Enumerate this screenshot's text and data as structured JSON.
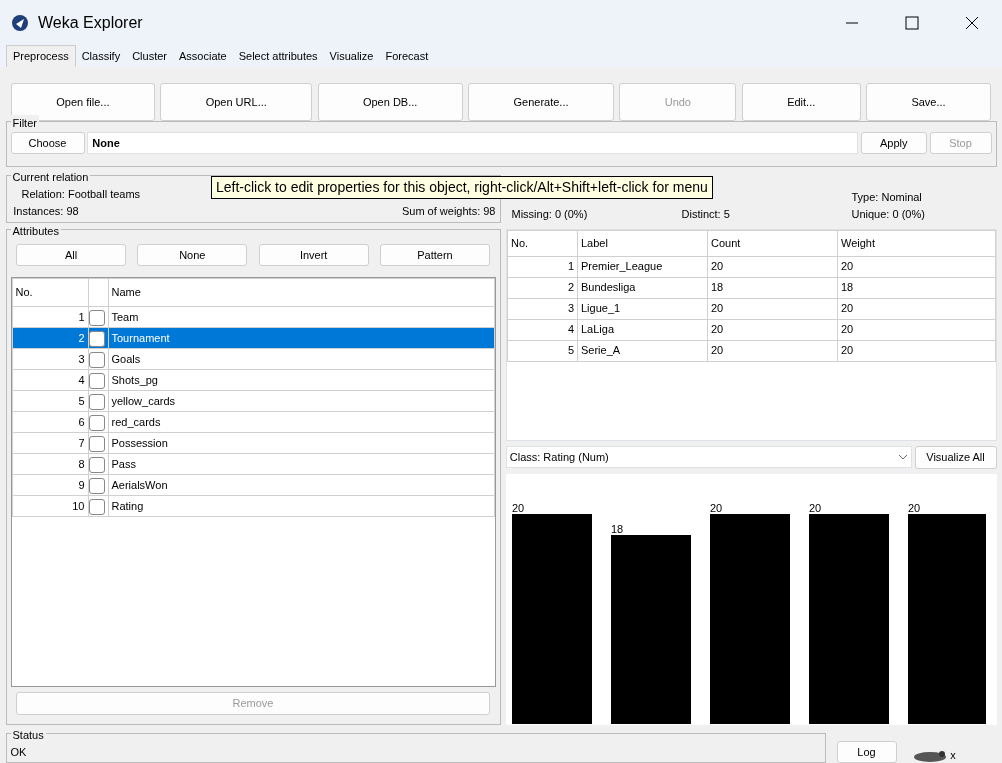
{
  "window": {
    "title": "Weka Explorer"
  },
  "tabs": [
    {
      "label": "Preprocess",
      "selected": true
    },
    {
      "label": "Classify",
      "selected": false
    },
    {
      "label": "Cluster",
      "selected": false
    },
    {
      "label": "Associate",
      "selected": false
    },
    {
      "label": "Select attributes",
      "selected": false
    },
    {
      "label": "Visualize",
      "selected": false
    },
    {
      "label": "Forecast",
      "selected": false
    }
  ],
  "toolbar": [
    {
      "label": "Open file...",
      "disabled": false
    },
    {
      "label": "Open URL...",
      "disabled": false
    },
    {
      "label": "Open DB...",
      "disabled": false
    },
    {
      "label": "Generate...",
      "disabled": false
    },
    {
      "label": "Undo",
      "disabled": true
    },
    {
      "label": "Edit...",
      "disabled": false
    },
    {
      "label": "Save...",
      "disabled": false
    }
  ],
  "filter": {
    "title": "Filter",
    "choose": "Choose",
    "value": "None",
    "apply": {
      "label": "Apply",
      "disabled": false
    },
    "stop": {
      "label": "Stop",
      "disabled": true
    }
  },
  "tooltip": "Left-click to edit properties for this object, right-click/Alt+Shift+left-click for menu",
  "current_relation": {
    "title": "Current relation",
    "relation": "Relation: Football teams",
    "instances": "Instances: 98",
    "sum_of_weights": "Sum of weights: 98"
  },
  "attributes": {
    "title": "Attributes",
    "buttons": [
      "All",
      "None",
      "Invert",
      "Pattern"
    ],
    "columns": [
      "No.",
      "Name"
    ],
    "rows": [
      {
        "no": "1",
        "name": "Team",
        "checked": false,
        "selected": false
      },
      {
        "no": "2",
        "name": "Tournament",
        "checked": false,
        "selected": true
      },
      {
        "no": "3",
        "name": "Goals",
        "checked": false,
        "selected": false
      },
      {
        "no": "4",
        "name": "Shots_pg",
        "checked": false,
        "selected": false
      },
      {
        "no": "5",
        "name": "yellow_cards",
        "checked": false,
        "selected": false
      },
      {
        "no": "6",
        "name": "red_cards",
        "checked": false,
        "selected": false
      },
      {
        "no": "7",
        "name": "Possession",
        "checked": false,
        "selected": false
      },
      {
        "no": "8",
        "name": "Pass",
        "checked": false,
        "selected": false
      },
      {
        "no": "9",
        "name": "AerialsWon",
        "checked": false,
        "selected": false
      },
      {
        "no": "10",
        "name": "Rating",
        "checked": false,
        "selected": false
      }
    ],
    "remove": {
      "label": "Remove",
      "disabled": true
    }
  },
  "selected_attribute": {
    "type": "Type: Nominal",
    "missing": "Missing: 0 (0%)",
    "distinct": "Distinct: 5",
    "unique": "Unique: 0 (0%)",
    "columns": [
      "No.",
      "Label",
      "Count",
      "Weight"
    ],
    "rows": [
      [
        "1",
        "Premier_League",
        "20",
        "20"
      ],
      [
        "2",
        "Bundesliga",
        "18",
        "18"
      ],
      [
        "3",
        "Ligue_1",
        "20",
        "20"
      ],
      [
        "4",
        "LaLiga",
        "20",
        "20"
      ],
      [
        "5",
        "Serie_A",
        "20",
        "20"
      ]
    ]
  },
  "class_select": "Class: Rating (Num)",
  "visualize_all": "Visualize All",
  "histogram": {
    "bar_labels": [
      "20",
      "18",
      "20",
      "20",
      "20"
    ]
  },
  "status": {
    "title": "Status",
    "text": "OK",
    "log": "Log",
    "count": "x"
  }
}
